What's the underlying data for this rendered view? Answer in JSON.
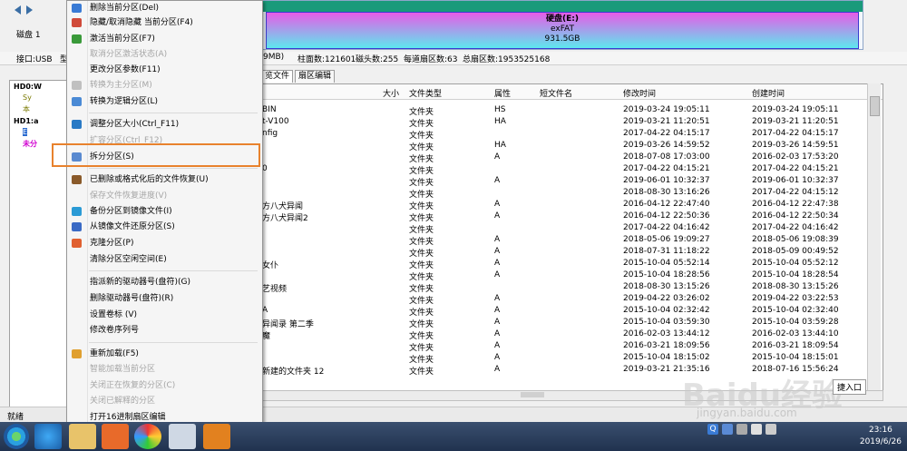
{
  "window": {
    "disk_label": "磁盘 1",
    "partition_name": "硬盘(E:)",
    "partition_fs": "exFAT",
    "partition_size": "931.5GB",
    "info_interface": "接口:USB",
    "info_truncated": "型",
    "info_mb": "9MB)",
    "info_cylinders": "柱面数:121601",
    "info_heads": "磁头数:255",
    "info_sectors": "每道扇区数:63",
    "info_total": "总扇区数:1953525168",
    "status": "就绪"
  },
  "tree": [
    {
      "label": "HD0:W",
      "kind": "disk"
    },
    {
      "label": "Sy",
      "kind": "part"
    },
    {
      "label": "本",
      "kind": "part"
    },
    {
      "label": "HD1:a",
      "kind": "disk"
    },
    {
      "label": "E",
      "kind": "part"
    },
    {
      "label": "未分",
      "kind": "unassigned"
    }
  ],
  "tabs": [
    "览文件",
    "扇区编辑"
  ],
  "columns": {
    "size": "大小",
    "type": "文件类型",
    "attr": "属性",
    "short": "短文件名",
    "mtime": "修改时间",
    "ctime": "创建时间"
  },
  "files": [
    {
      "name": "BIN",
      "type": "文件夹",
      "attr": "HS",
      "mtime": "2019-03-24 19:05:11",
      "ctime": "2019-03-24 19:05:11"
    },
    {
      "name": "t-V100",
      "type": "文件夹",
      "attr": "HA",
      "mtime": "2019-03-21 11:20:51",
      "ctime": "2019-03-21 11:20:51"
    },
    {
      "name": "nfig",
      "type": "文件夹",
      "attr": "",
      "mtime": "2017-04-22 04:15:17",
      "ctime": "2017-04-22 04:15:17"
    },
    {
      "name": "",
      "type": "文件夹",
      "attr": "HA",
      "mtime": "2019-03-26 14:59:52",
      "ctime": "2019-03-26 14:59:51"
    },
    {
      "name": "",
      "type": "文件夹",
      "attr": "A",
      "mtime": "2018-07-08 17:03:00",
      "ctime": "2016-02-03 17:53:20"
    },
    {
      "name": "0",
      "type": "文件夹",
      "attr": "",
      "mtime": "2017-04-22 04:15:21",
      "ctime": "2017-04-22 04:15:21"
    },
    {
      "name": "",
      "type": "文件夹",
      "attr": "A",
      "mtime": "2019-06-01 10:32:37",
      "ctime": "2019-06-01 10:32:37"
    },
    {
      "name": "",
      "type": "文件夹",
      "attr": "",
      "mtime": "2018-08-30 13:16:26",
      "ctime": "2017-04-22 04:15:12"
    },
    {
      "name": "方八犬异闻",
      "type": "文件夹",
      "attr": "A",
      "mtime": "2016-04-12 22:47:40",
      "ctime": "2016-04-12 22:47:38"
    },
    {
      "name": "方八犬异闻2",
      "type": "文件夹",
      "attr": "A",
      "mtime": "2016-04-12 22:50:36",
      "ctime": "2016-04-12 22:50:34"
    },
    {
      "name": "",
      "type": "文件夹",
      "attr": "",
      "mtime": "2017-04-22 04:16:42",
      "ctime": "2017-04-22 04:16:42"
    },
    {
      "name": "",
      "type": "文件夹",
      "attr": "A",
      "mtime": "2018-05-06 19:09:27",
      "ctime": "2018-05-06 19:08:39"
    },
    {
      "name": "",
      "type": "文件夹",
      "attr": "A",
      "mtime": "2018-07-31 11:18:22",
      "ctime": "2018-05-09 00:49:52"
    },
    {
      "name": "女仆",
      "type": "文件夹",
      "attr": "A",
      "mtime": "2015-10-04 05:52:14",
      "ctime": "2015-10-04 05:52:12"
    },
    {
      "name": "",
      "type": "文件夹",
      "attr": "A",
      "mtime": "2015-10-04 18:28:56",
      "ctime": "2015-10-04 18:28:54"
    },
    {
      "name": "艺视频",
      "type": "文件夹",
      "attr": "",
      "mtime": "2018-08-30 13:15:26",
      "ctime": "2018-08-30 13:15:26"
    },
    {
      "name": "",
      "type": "文件夹",
      "attr": "A",
      "mtime": "2019-04-22 03:26:02",
      "ctime": "2019-04-22 03:22:53"
    },
    {
      "name": "A",
      "type": "文件夹",
      "attr": "A",
      "mtime": "2015-10-04 02:32:42",
      "ctime": "2015-10-04 02:32:40"
    },
    {
      "name": "异闻录 第二季",
      "type": "文件夹",
      "attr": "A",
      "mtime": "2015-10-04 03:59:30",
      "ctime": "2015-10-04 03:59:28"
    },
    {
      "name": "魔",
      "type": "文件夹",
      "attr": "A",
      "mtime": "2016-02-03 13:44:12",
      "ctime": "2016-02-03 13:44:10"
    },
    {
      "name": "",
      "type": "文件夹",
      "attr": "A",
      "mtime": "2016-03-21 18:09:56",
      "ctime": "2016-03-21 18:09:54"
    },
    {
      "name": "",
      "type": "文件夹",
      "attr": "A",
      "mtime": "2015-10-04 18:15:02",
      "ctime": "2015-10-04 18:15:01"
    },
    {
      "name": "新建的文件夹 12",
      "type": "文件夹",
      "attr": "A",
      "mtime": "2019-03-21 21:35:16",
      "ctime": "2018-07-16 15:56:24"
    }
  ],
  "menu": [
    {
      "label": "删除当前分区(Del)",
      "disabled": false,
      "icon": "#3a7bd5"
    },
    {
      "label": "隐藏/取消隐藏 当前分区(F4)",
      "disabled": false,
      "icon": "#d04a3a"
    },
    {
      "label": "激活当前分区(F7)",
      "disabled": false,
      "icon": "#3a9a3a"
    },
    {
      "label": "取消分区激活状态(A)",
      "disabled": true,
      "icon": ""
    },
    {
      "label": "更改分区参数(F11)",
      "disabled": false,
      "icon": ""
    },
    {
      "label": "转换为主分区(M)",
      "disabled": true,
      "icon": "#c0c0c0"
    },
    {
      "label": "转换为逻辑分区(L)",
      "disabled": false,
      "icon": "#4a8ad5"
    },
    {
      "label": "调整分区大小(Ctrl_F11)",
      "disabled": false,
      "icon": "#2a7ac5"
    },
    {
      "label": "扩容分区(Ctrl_F12)",
      "disabled": true,
      "icon": ""
    },
    {
      "label": "拆分分区(S)",
      "disabled": false,
      "icon": "#5a8ad0"
    },
    {
      "label": "已删除或格式化后的文件恢复(U)",
      "disabled": false,
      "icon": "#8a5a2a"
    },
    {
      "label": "保存文件恢复进度(V)",
      "disabled": true,
      "icon": ""
    },
    {
      "label": "备份分区到镜像文件(I)",
      "disabled": false,
      "icon": "#2a9ad5"
    },
    {
      "label": "从镜像文件还原分区(S)",
      "disabled": false,
      "icon": "#3a6ac5"
    },
    {
      "label": "克隆分区(P)",
      "disabled": false,
      "icon": "#e06030"
    },
    {
      "label": "清除分区空闲空间(E)",
      "disabled": false,
      "icon": ""
    },
    {
      "label": "指派新的驱动器号(盘符)(G)",
      "disabled": false,
      "icon": ""
    },
    {
      "label": "删除驱动器号(盘符)(R)",
      "disabled": false,
      "icon": ""
    },
    {
      "label": "设置卷标 (V)",
      "disabled": false,
      "icon": ""
    },
    {
      "label": "修改卷序列号",
      "disabled": false,
      "icon": ""
    },
    {
      "label": "重新加载(F5)",
      "disabled": false,
      "icon": "#e0a030"
    },
    {
      "label": "智能加载当前分区",
      "disabled": true,
      "icon": ""
    },
    {
      "label": "关闭正在恢复的分区(C)",
      "disabled": true,
      "icon": ""
    },
    {
      "label": "关闭已解释的分区",
      "disabled": true,
      "icon": ""
    },
    {
      "label": "打开16进制扇区编辑",
      "disabled": false,
      "icon": ""
    }
  ],
  "overlay": {
    "shortcut": "捷入口",
    "watermark": "Baidu经验",
    "watermark_sub": "jingyan.baidu.com"
  },
  "taskbar": {
    "time": "23:16",
    "date": "2019/6/26",
    "lang": "Q"
  }
}
